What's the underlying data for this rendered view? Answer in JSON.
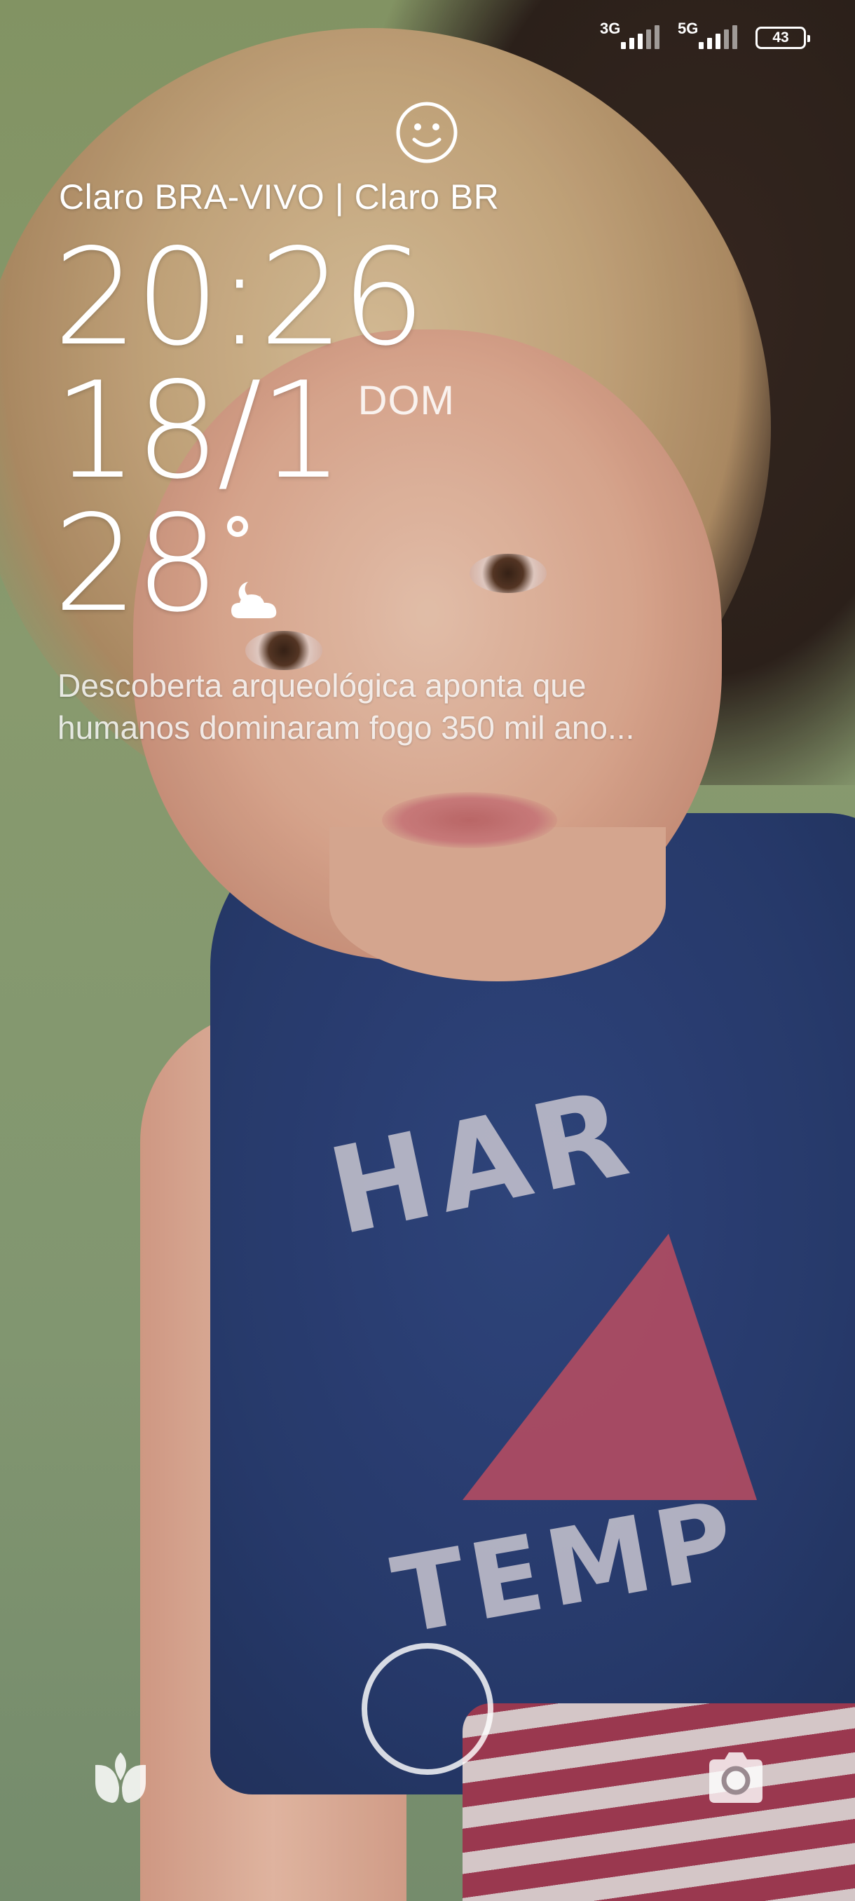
{
  "status_bar": {
    "network_1": "3G",
    "network_2": "5G",
    "battery_level": "43",
    "icons": [
      "signal-icon",
      "signal-icon",
      "battery-icon"
    ]
  },
  "lockscreen": {
    "face_unlock_icon": "smiley-icon",
    "carrier": "Claro BRA-VIVO | Claro BR",
    "time": "20:26",
    "date": "18/1",
    "weekday": "DOM",
    "temperature": "28",
    "weather_icon": "partly-cloudy-night-icon",
    "news_line_1": "Descoberta arqueológica aponta que",
    "news_line_2": "humanos dominaram fogo 350 mil ano..."
  },
  "actions": {
    "left_shortcut_icon": "petals-icon",
    "center": "unlock-ring",
    "right_shortcut_icon": "camera-icon"
  },
  "colors": {
    "text": "#ffffff",
    "news_text": "rgba(255,255,255,0.82)"
  }
}
